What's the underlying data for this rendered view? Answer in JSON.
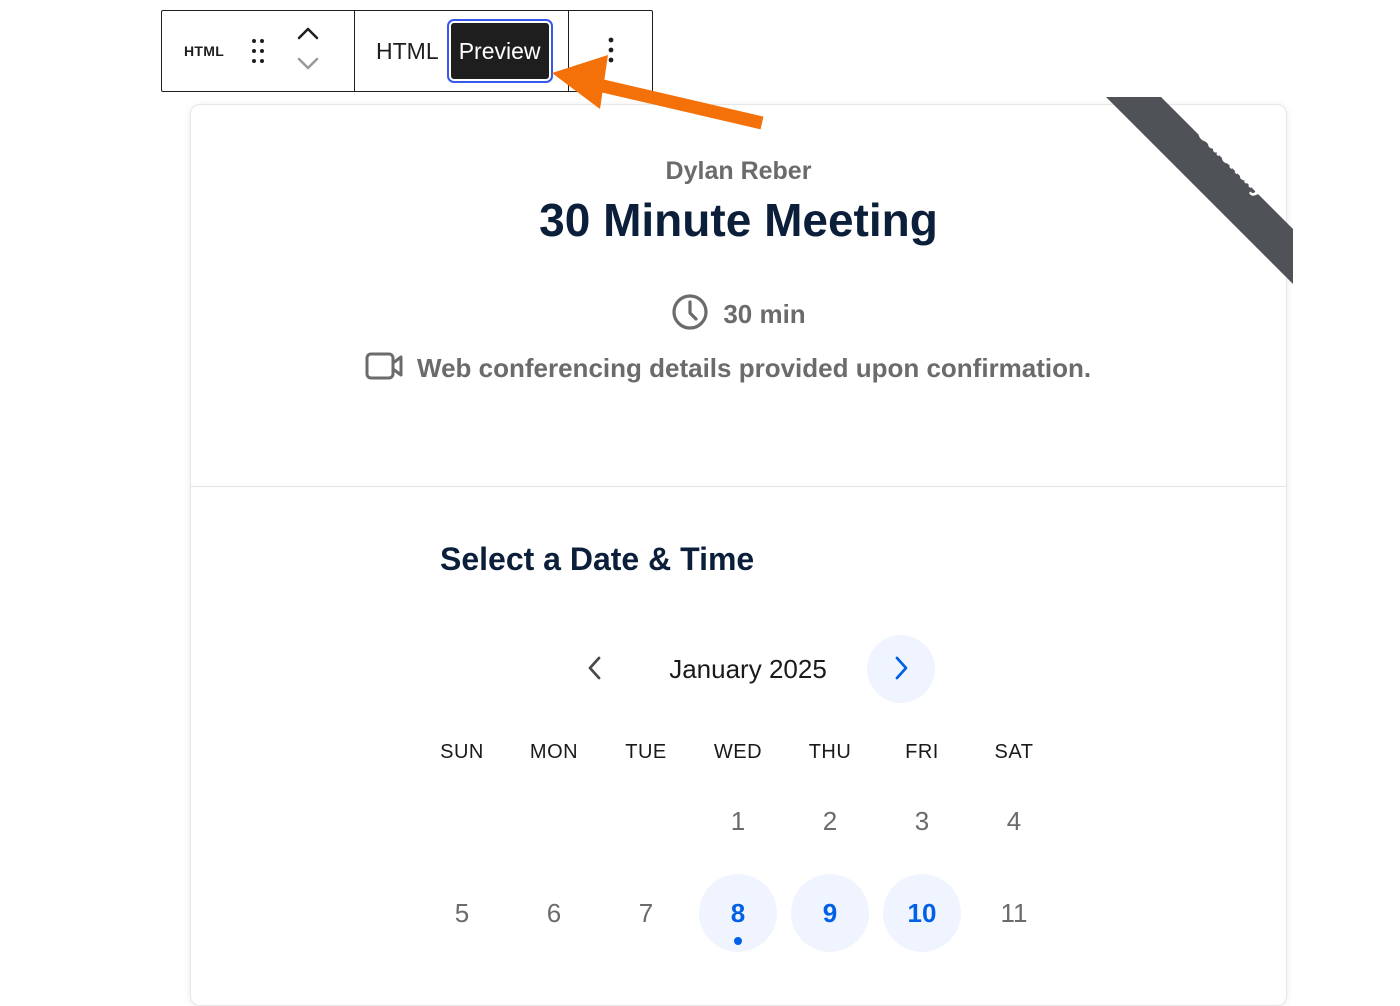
{
  "toolbar": {
    "block_label": "HTML",
    "html_label": "HTML",
    "preview_label": "Preview",
    "active_mode": "Preview",
    "highlight_color": "#3858e9"
  },
  "annotation": {
    "color": "#f4710a",
    "icon": "arrow-icon"
  },
  "badge": {
    "top_text": "POWERED BY",
    "brand": "Calendly",
    "color": "#4f5358"
  },
  "event": {
    "organizer": "Dylan Reber",
    "title": "30 Minute Meeting",
    "duration": "30 min",
    "duration_icon": "clock-icon",
    "conferencing": "Web conferencing details provided upon confirmation.",
    "conferencing_icon": "video-camera-icon"
  },
  "calendar": {
    "heading": "Select a Date & Time",
    "month": "January 2025",
    "prev_icon": "chevron-left-icon",
    "next_icon": "chevron-right-icon",
    "accent": "#0060e6",
    "weekdays": [
      "SUN",
      "MON",
      "TUE",
      "WED",
      "THU",
      "FRI",
      "SAT"
    ],
    "days": [
      {
        "label": "",
        "state": "empty"
      },
      {
        "label": "",
        "state": "empty"
      },
      {
        "label": "",
        "state": "empty"
      },
      {
        "label": "1",
        "state": "unavailable"
      },
      {
        "label": "2",
        "state": "unavailable"
      },
      {
        "label": "3",
        "state": "unavailable"
      },
      {
        "label": "4",
        "state": "unavailable"
      },
      {
        "label": "5",
        "state": "unavailable"
      },
      {
        "label": "6",
        "state": "unavailable"
      },
      {
        "label": "7",
        "state": "unavailable"
      },
      {
        "label": "8",
        "state": "available",
        "today": true
      },
      {
        "label": "9",
        "state": "available"
      },
      {
        "label": "10",
        "state": "available"
      },
      {
        "label": "11",
        "state": "unavailable"
      }
    ]
  }
}
